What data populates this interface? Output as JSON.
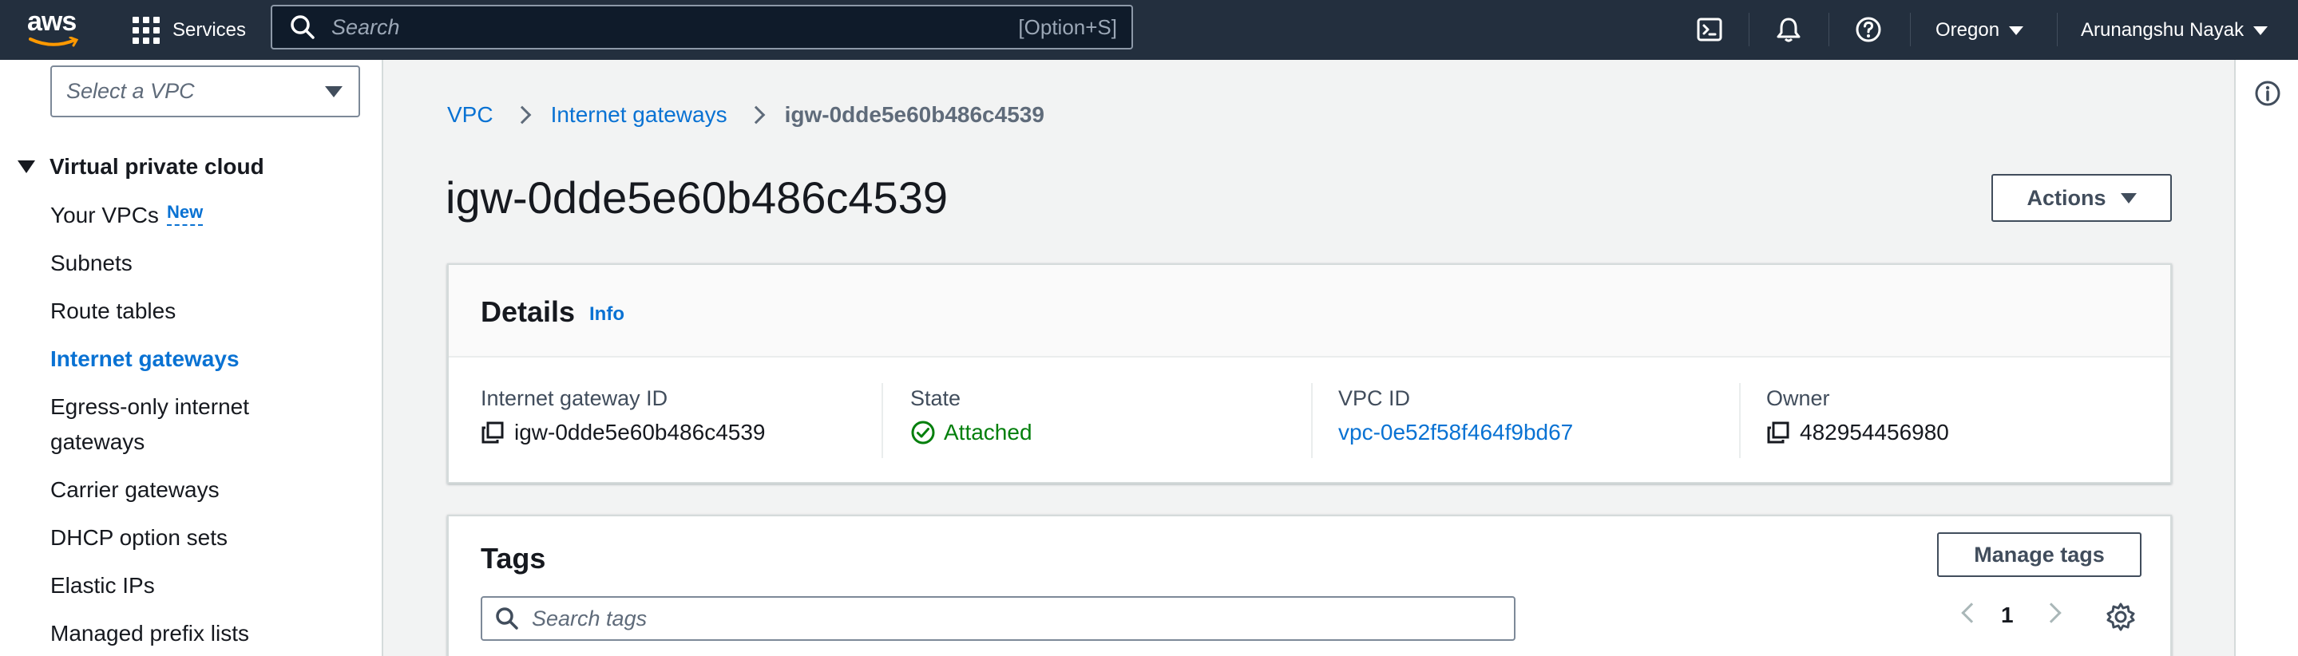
{
  "topnav": {
    "logo_text": "aws",
    "services_label": "Services",
    "search_placeholder": "Search",
    "search_shortcut": "[Option+S]",
    "icons": [
      "cloudshell-icon",
      "bell-icon",
      "help-icon"
    ],
    "region": "Oregon",
    "user": "Arunangshu Nayak"
  },
  "sidebar": {
    "vpc_select_placeholder": "Select a VPC",
    "section_title": "Virtual private cloud",
    "new_badge": "New",
    "items": [
      {
        "label": "Your VPCs",
        "active": false
      },
      {
        "label": "Subnets",
        "active": false
      },
      {
        "label": "Route tables",
        "active": false
      },
      {
        "label": "Internet gateways",
        "active": true
      },
      {
        "label": "Egress-only internet",
        "label_line2": "gateways",
        "active": false
      },
      {
        "label": "Carrier gateways",
        "active": false
      },
      {
        "label": "DHCP option sets",
        "active": false
      },
      {
        "label": "Elastic IPs",
        "active": false
      },
      {
        "label": "Managed prefix lists",
        "active": false
      }
    ]
  },
  "breadcrumb": {
    "items": [
      "VPC",
      "Internet gateways"
    ],
    "current": "igw-0dde5e60b486c4539"
  },
  "page": {
    "title": "igw-0dde5e60b486c4539",
    "actions_label": "Actions"
  },
  "details": {
    "title": "Details",
    "info_label": "Info",
    "columns": [
      {
        "label": "Internet gateway ID",
        "value": "igw-0dde5e60b486c4539"
      },
      {
        "label": "State",
        "value": "Attached"
      },
      {
        "label": "VPC ID",
        "value": "vpc-0e52f58f464f9bd67"
      },
      {
        "label": "Owner",
        "value": "482954456980"
      }
    ]
  },
  "tags": {
    "title": "Tags",
    "manage_label": "Manage tags",
    "search_placeholder": "Search tags",
    "page_number": "1"
  },
  "colors": {
    "nav_bg": "#232f3e",
    "link": "#0972d3",
    "success": "#037f0c",
    "page_bg": "#f2f3f3"
  }
}
